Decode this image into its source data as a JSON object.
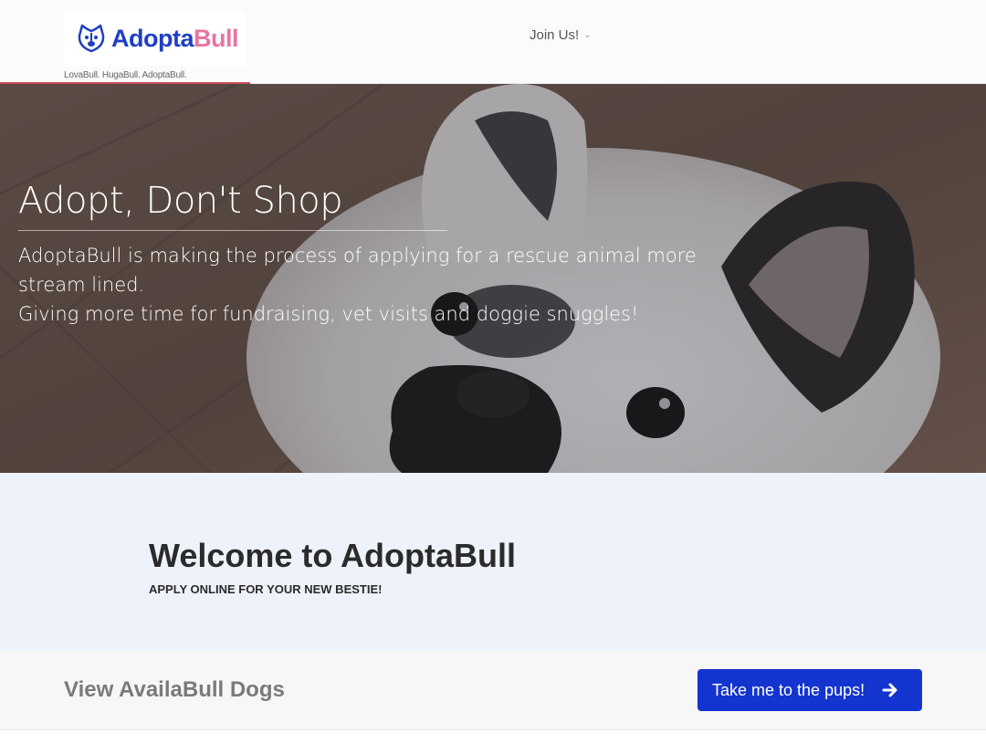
{
  "header": {
    "logo": {
      "part1": "Adopta",
      "part2": "Bull"
    },
    "tagline": "LovaBull. HugaBull. AdoptaBull.",
    "nav": {
      "join_label": "Join Us!"
    }
  },
  "hero": {
    "title": "Adopt, Don't Shop",
    "line1": "AdoptaBull is making the process of applying for a rescue animal more stream lined.",
    "line2": "Giving more time for fundraising, vet visits and doggie snuggles!"
  },
  "welcome": {
    "heading": "Welcome to AdoptaBull",
    "subtitle": "APPLY ONLINE FOR YOUR NEW BESTIE!"
  },
  "cta": {
    "label": "View AvailaBull Dogs",
    "button_label": "Take me to the pups!"
  },
  "colors": {
    "brand_blue": "#1e3fc4",
    "brand_pink": "#e8749f",
    "button_blue": "#1434cf",
    "welcome_bg": "#eef2fa"
  },
  "icons": [
    "dog-face-logo-icon",
    "chevron-down-icon",
    "arrow-right-icon"
  ]
}
